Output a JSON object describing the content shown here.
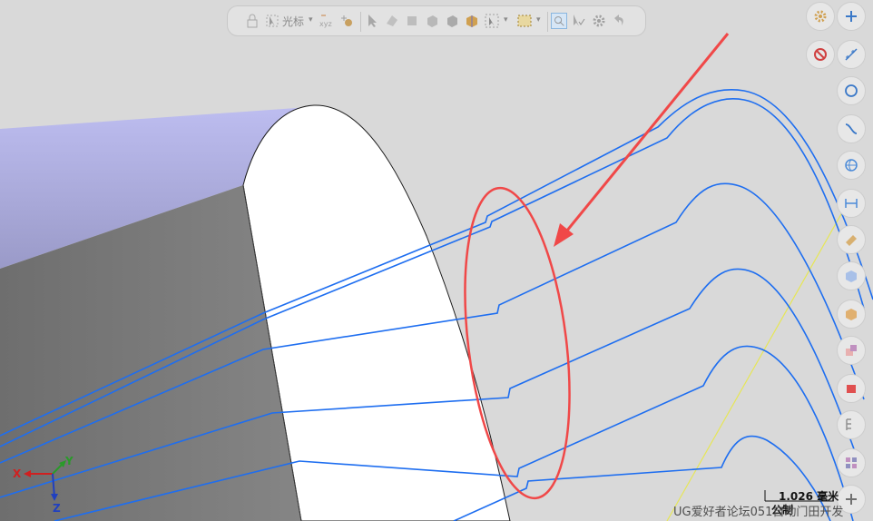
{
  "toolbar": {
    "cursor_label": "光标",
    "cursor_label_dropdown": "▾"
  },
  "triad": {
    "x_label": "X",
    "y_label": "Y",
    "z_label": "Z"
  },
  "scale_bar": {
    "value": "1.026 毫米",
    "unit_system": "公制"
  },
  "watermark": "UG爱好者论坛051自动门田开发",
  "colors": {
    "background": "#d9d9d9",
    "curve_blue": "#1e6ef0",
    "annotation_red": "#f04848",
    "guide_yellow": "#e6e657",
    "solid_top": "#a9a9d9",
    "solid_side": "#7a7a7a",
    "solid_face": "#ffffff"
  }
}
